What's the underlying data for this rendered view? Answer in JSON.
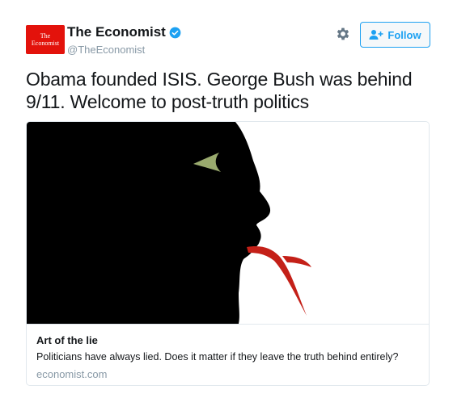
{
  "account": {
    "display_name": "The Economist",
    "handle": "@TheEconomist",
    "logo_line1": "The",
    "logo_line2": "Economist",
    "verified": true
  },
  "actions": {
    "follow_label": "Follow",
    "settings_icon": "gear-icon"
  },
  "tweet": {
    "text": "Obama founded ISIS. George Bush was behind 9/11. Welcome to post-truth politics"
  },
  "card": {
    "title": "Art of the lie",
    "description": "Politicians have always lied. Does it matter if they leave the truth behind entirely?",
    "domain": "economist.com"
  },
  "colors": {
    "brand_red": "#e3120b",
    "twitter_blue": "#1da1f2",
    "muted_text": "#8899a6"
  }
}
